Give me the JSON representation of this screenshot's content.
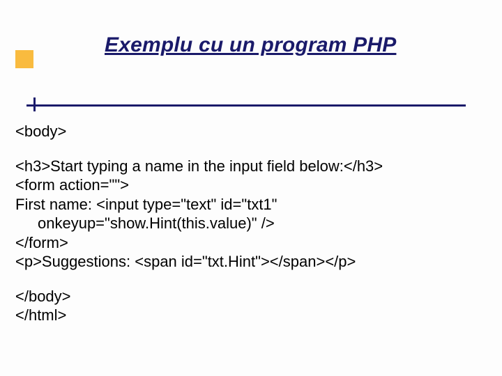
{
  "slide": {
    "title": "Exemplu cu un program PHP",
    "code": {
      "line1": "<body>",
      "line2": "<h3>Start typing a name in the input field below:</h3>",
      "line3": "<form action=\"\">",
      "line4": "First name: <input type=\"text\" id=\"txt1\"",
      "line5": "onkeyup=\"show.Hint(this.value)\" />",
      "line6": "</form>",
      "line7": "<p>Suggestions: <span id=\"txt.Hint\"></span></p>",
      "line8": "</body>",
      "line9": "</html>"
    }
  }
}
